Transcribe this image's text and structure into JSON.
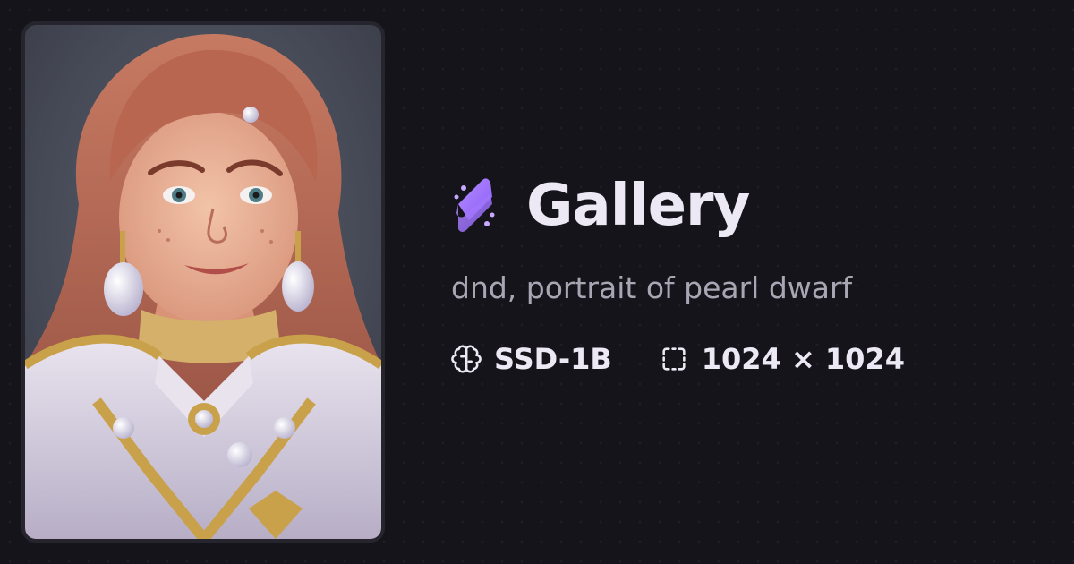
{
  "brand": {
    "title": "Gallery",
    "logo_icon": "stability-gear-logo-icon",
    "accent": "#a27cf4"
  },
  "image": {
    "alt": "dnd, portrait of pearl dwarf"
  },
  "prompt": "dnd, portrait of pearl dwarf",
  "meta": {
    "model": {
      "icon": "brain-icon",
      "label": "SSD-1B"
    },
    "size": {
      "icon": "dashed-square-icon",
      "label": "1024 × 1024"
    }
  }
}
